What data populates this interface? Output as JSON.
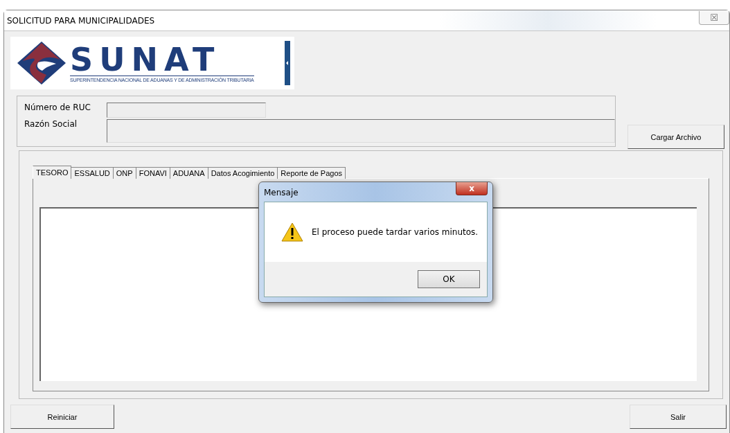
{
  "window": {
    "title": "SOLICITUD PARA MUNICIPALIDADES",
    "close_label": "☒"
  },
  "logo": {
    "name": "SUNAT",
    "subtitle": "SUPERINTENDENCIA NACIONAL DE ADUANAS Y DE ADMINISTRACIÓN TRIBUTARIA"
  },
  "fields": [
    {
      "label": "Número de RUC",
      "kind": "short"
    },
    {
      "label": "Razón Social",
      "kind": "wide"
    }
  ],
  "load_button": "Cargar Archivo",
  "tabs": [
    {
      "label": "TESORO",
      "selected": true
    },
    {
      "label": "ESSALUD",
      "selected": false
    },
    {
      "label": "ONP",
      "selected": false
    },
    {
      "label": "FONAVI",
      "selected": false
    },
    {
      "label": "ADUANA",
      "selected": false
    },
    {
      "label": "Datos Acogimiento",
      "selected": false
    },
    {
      "label": "Reporte de Pagos",
      "selected": false
    }
  ],
  "dialog": {
    "title": "Mensaje",
    "message": "El proceso puede tardar varios minutos.",
    "button": "OK",
    "close_label": "x"
  },
  "buttons": [
    {
      "label": "Reiniciar",
      "kind": "left"
    },
    {
      "label": "Salir",
      "kind": "right"
    }
  ]
}
